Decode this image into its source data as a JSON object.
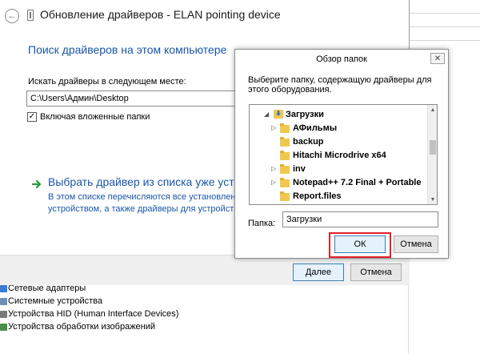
{
  "background": {
    "device_list": [
      {
        "label": "Сетевые адаптеры",
        "icon": "network-adapter-icon",
        "color": "#3a7bd5"
      },
      {
        "label": "Системные устройства",
        "icon": "system-device-icon",
        "color": "#6d8fb3"
      },
      {
        "label": "Устройства HID (Human Interface Devices)",
        "icon": "hid-device-icon",
        "color": "#7a7a7a"
      },
      {
        "label": "Устройства обработки изображений",
        "icon": "imaging-device-icon",
        "color": "#4c8c4a"
      }
    ]
  },
  "wizard": {
    "title": "Обновление драйверов - ELAN pointing device",
    "heading": "Поиск драйверов на этом компьютере",
    "search_label": "Искать драйверы в следующем месте:",
    "path_value": "C:\\Users\\Админ\\Desktop",
    "include_subfolders_label": "Включая вложенные папки",
    "include_subfolders_checked": true,
    "pick_title": "Выбрать драйвер из списка уже установ",
    "pick_desc_line1": "В этом списке перечисляются все установленные д",
    "pick_desc_line2": "устройством, а также драйверы для устройств той",
    "next_label": "Далее",
    "cancel_label": "Отмена"
  },
  "dialog": {
    "title": "Обзор папок",
    "close_glyph": "✕",
    "description": "Выберите папку, содержащую драйверы для этого оборудования.",
    "tree": [
      {
        "label": "Загрузки",
        "kind": "downloads",
        "expanded": true,
        "bold": true
      },
      {
        "label": "АФильмы",
        "kind": "folder",
        "expandable": true,
        "bold": true
      },
      {
        "label": "backup",
        "kind": "folder",
        "expandable": false,
        "bold": true
      },
      {
        "label": "Hitachi Microdrive x64",
        "kind": "folder",
        "expandable": false,
        "bold": true
      },
      {
        "label": "inv",
        "kind": "folder",
        "expandable": true,
        "bold": true
      },
      {
        "label": "Notepad++ 7.2 Final + Portable",
        "kind": "folder",
        "expandable": true,
        "bold": true
      },
      {
        "label": "Report.files",
        "kind": "folder",
        "expandable": false,
        "bold": true
      }
    ],
    "folder_label": "Папка:",
    "folder_value": "Загрузки",
    "ok_label": "ОК",
    "cancel_label": "Отмена",
    "highlight_color": "#e3202a"
  }
}
